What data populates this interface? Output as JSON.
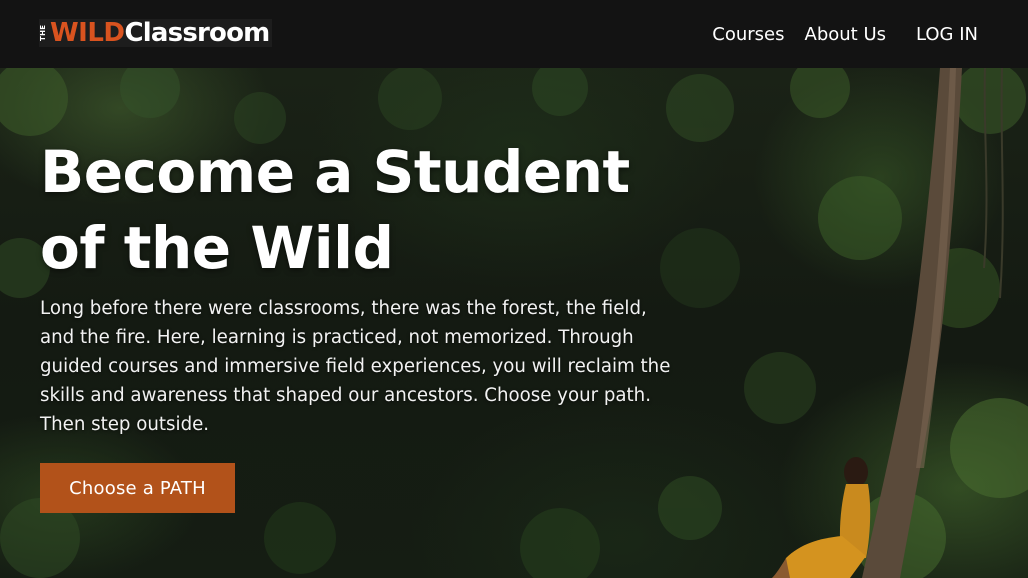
{
  "header": {
    "logo": {
      "the": "THE",
      "wild": "WILD",
      "classroom": "Classroom"
    },
    "nav": [
      {
        "label": "Courses"
      },
      {
        "label": "About Us"
      },
      {
        "label": "LOG IN"
      }
    ]
  },
  "hero": {
    "title_line1": "Become a Student",
    "title_line2": "of the Wild",
    "body": "Long before there were classrooms, there was the forest, the field, and the fire. Here, learning is practiced, not memorized. Through guided courses and immersive field experiences, you will reclaim the skills and awareness that shaped our ancestors. Choose your path. Then step outside.",
    "cta_label": "Choose a PATH",
    "background_image": "forest-woman-sitting-by-tree"
  },
  "colors": {
    "header_bg": "#131313",
    "brand_orange": "#d9531f",
    "cta_bg": "#b2521a",
    "text": "#ffffff"
  }
}
